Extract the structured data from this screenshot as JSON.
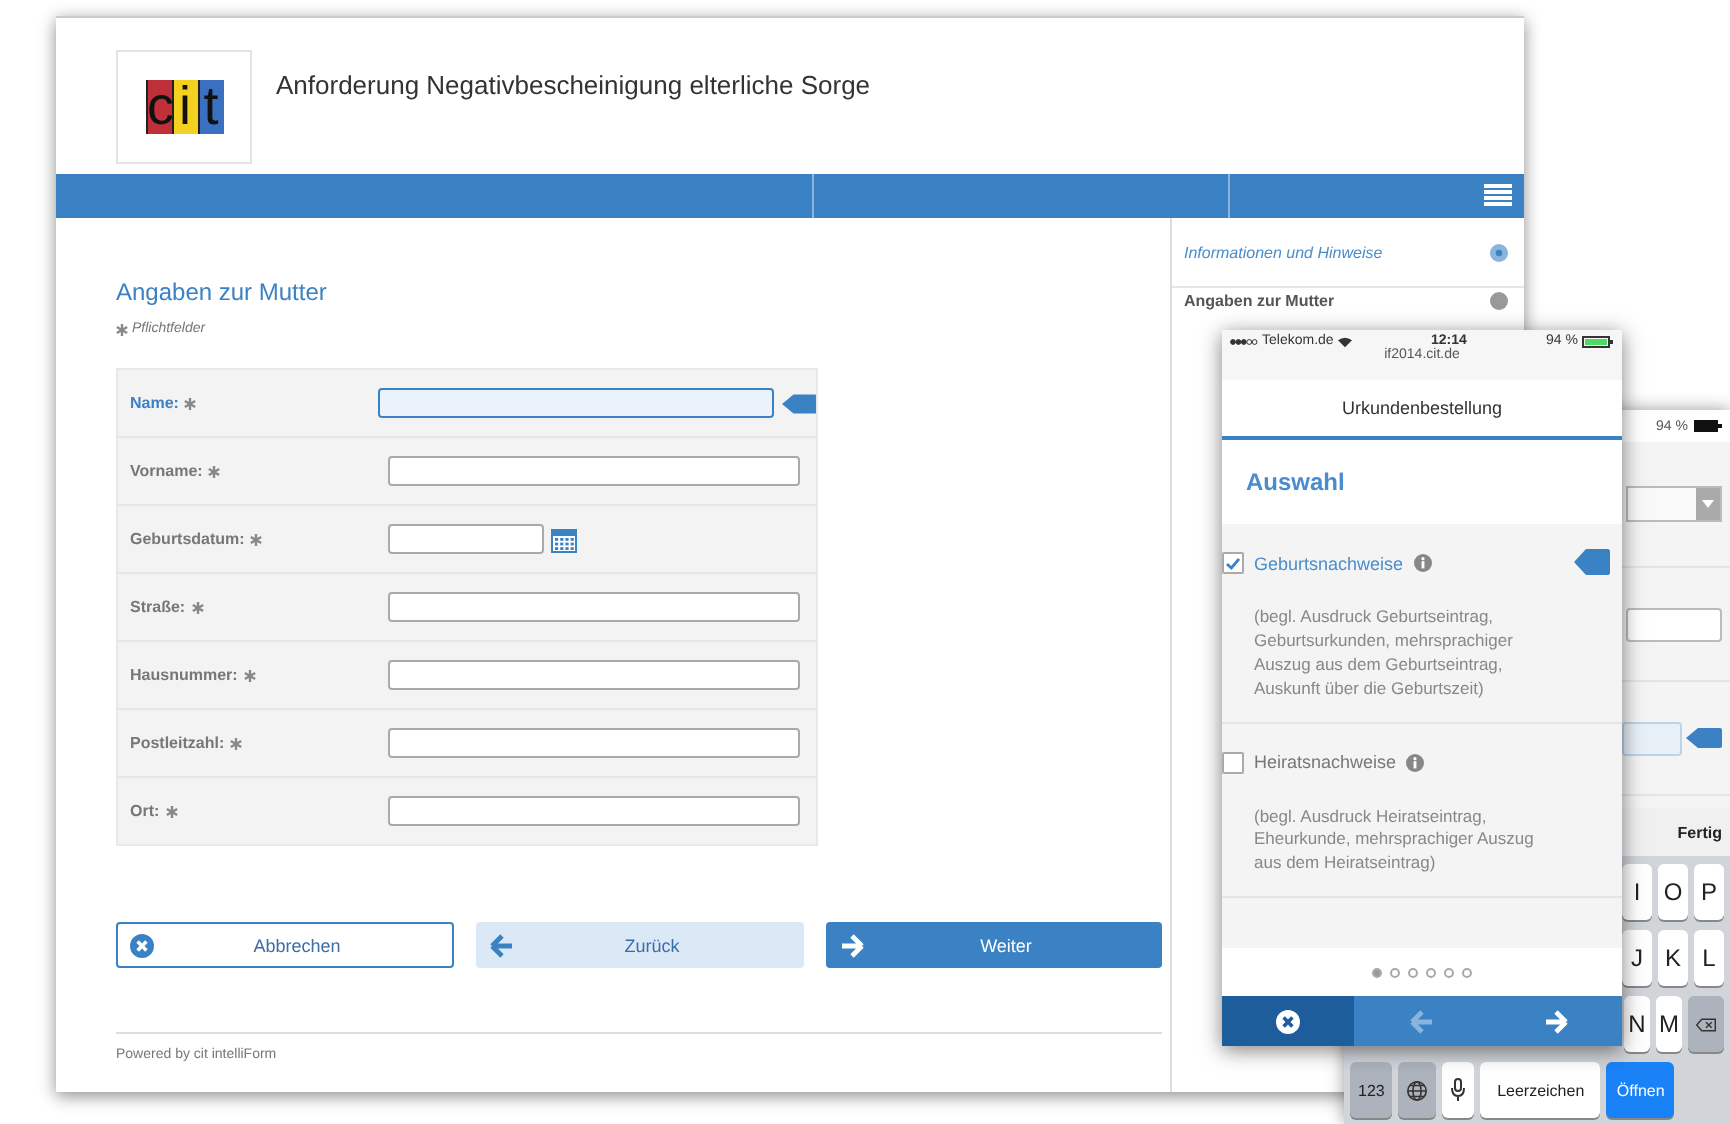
{
  "desktop": {
    "logo": "cit",
    "title": "Anforderung Negativbescheinigung elterliche Sorge",
    "sidebar": [
      {
        "label": "Informationen und Hinweise",
        "selected": true
      },
      {
        "label": "Angaben zur Mutter",
        "selected": false
      }
    ],
    "section_title": "Angaben zur Mutter",
    "required_note": "Pflichtfelder",
    "fields": [
      {
        "label": "Name:",
        "kind": "text",
        "focused": true
      },
      {
        "label": "Vorname:",
        "kind": "text",
        "focused": false
      },
      {
        "label": "Geburtsdatum:",
        "kind": "date",
        "focused": false
      },
      {
        "label": "Straße:",
        "kind": "text",
        "focused": false
      },
      {
        "label": "Hausnummer:",
        "kind": "text",
        "focused": false
      },
      {
        "label": "Postleitzahl:",
        "kind": "text",
        "focused": false
      },
      {
        "label": "Ort:",
        "kind": "text",
        "focused": false
      }
    ],
    "buttons": [
      {
        "label": "Abbrechen",
        "kind": "cancel"
      },
      {
        "label": "Zurück",
        "kind": "back"
      },
      {
        "label": "Weiter",
        "kind": "next"
      }
    ],
    "footer": "Powered by cit intelliForm"
  },
  "phone": {
    "carrier": "Telekom.de",
    "time": "12:14",
    "battery": "94 %",
    "url": "if2014.cit.de",
    "title": "Urkundenbestellung",
    "section_title": "Auswahl",
    "options": [
      {
        "label": "Geburtsnachweise",
        "checked": true,
        "description": "(begl. Ausdruck Geburtseintrag, Geburtsurkunden, mehrsprachiger Auszug aus dem Geburtseintrag, Auskunft über die Geburtszeit)"
      },
      {
        "label": "Heiratsnachweise",
        "checked": false,
        "description": "(begl. Ausdruck Heiratseintrag, Eheurkunde, mehrsprachiger Auszug aus dem Heiratseintrag)"
      }
    ],
    "pages": [
      {
        "selected": true
      },
      {
        "selected": false
      },
      {
        "selected": false
      },
      {
        "selected": false
      },
      {
        "selected": false
      },
      {
        "selected": false
      }
    ],
    "nav": [
      {
        "kind": "cancel",
        "disabled": false
      },
      {
        "kind": "back",
        "disabled": true
      },
      {
        "kind": "next",
        "disabled": false
      }
    ]
  },
  "tablet": {
    "battery": "94 %",
    "done": "Fertig",
    "key_rows": [
      [
        "I",
        "O",
        "P"
      ],
      [
        "J",
        "K",
        "L"
      ],
      [
        "N",
        "M"
      ]
    ],
    "bottom_keys": [
      {
        "kind": "text",
        "label": "123"
      },
      {
        "kind": "globe"
      },
      {
        "kind": "mic"
      },
      {
        "kind": "space",
        "label": "Leerzeichen"
      },
      {
        "kind": "action",
        "label": "Öffnen"
      }
    ]
  }
}
